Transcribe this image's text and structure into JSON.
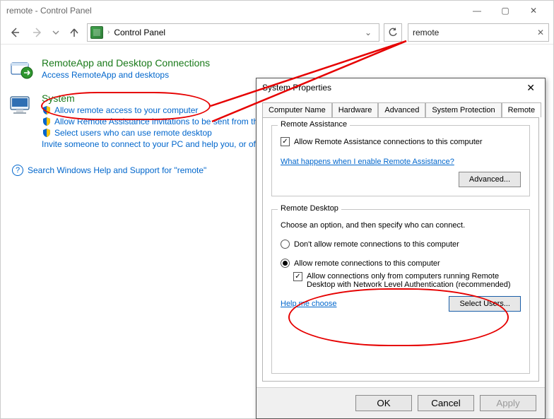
{
  "window": {
    "title": "remote - Control Panel",
    "breadcrumb": "Control Panel",
    "search_query": "remote"
  },
  "results": {
    "remoteapp": {
      "title": "RemoteApp and Desktop Connections",
      "sub1": "Access RemoteApp and desktops"
    },
    "system": {
      "title": "System",
      "allow_remote": "Allow remote access to your computer",
      "allow_ra_inv": "Allow Remote Assistance invitations to be sent from this computer",
      "select_users": "Select users who can use remote desktop",
      "invite": "Invite someone to connect to your PC and help you, or offer to help someone else"
    },
    "hint": "Search Windows Help and Support for \"remote\""
  },
  "dialog": {
    "title": "System Properties",
    "tabs": {
      "computer_name": "Computer Name",
      "hardware": "Hardware",
      "advanced": "Advanced",
      "system_protection": "System Protection",
      "remote": "Remote"
    },
    "ra": {
      "legend": "Remote Assistance",
      "allow": "Allow Remote Assistance connections to this computer",
      "whatlink": "What happens when I enable Remote Assistance?",
      "advanced_btn": "Advanced..."
    },
    "rd": {
      "legend": "Remote Desktop",
      "choose": "Choose an option, and then specify who can connect.",
      "opt_dont": "Don't allow remote connections to this computer",
      "opt_allow": "Allow remote connections to this computer",
      "nla": "Allow connections only from computers running Remote Desktop with Network Level Authentication (recommended)",
      "help": "Help me choose",
      "select_users_btn": "Select Users..."
    },
    "buttons": {
      "ok": "OK",
      "cancel": "Cancel",
      "apply": "Apply"
    }
  }
}
